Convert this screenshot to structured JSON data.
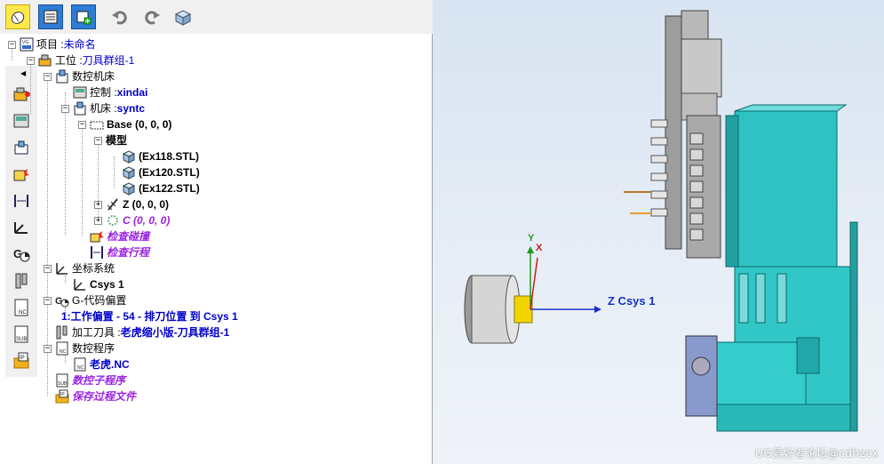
{
  "toolbar": {
    "buttons": [
      "mouse-select-icon",
      "document-list-icon",
      "add-component-icon",
      "undo-icon",
      "redo-icon",
      "view-cube-icon"
    ]
  },
  "tree": {
    "project_label": "项目 : ",
    "project_value": "未命名",
    "station_label": "工位 : ",
    "station_value": "刀具群组-1",
    "nc_machine": "数控机床",
    "control_label": "控制 : ",
    "control_value": "xindai",
    "machine_label": "机床 : ",
    "machine_value": "syntc",
    "base": "Base (0, 0, 0)",
    "model": "模型",
    "stl1": "(Ex118.STL)",
    "stl2": "(Ex120.STL)",
    "stl3": "(Ex122.STL)",
    "z_axis": "Z (0, 0, 0)",
    "c_axis": "C (0, 0, 0)",
    "collision": "检查碰撞",
    "travel": "检查行程",
    "coord_system": "坐标系统",
    "csys1": "Csys 1",
    "gcode_offset": "G-代码偏置",
    "offset_entry": "1:工作偏置 - 54 - 排刀位置 到 Csys 1",
    "tool_label": "加工刀具 : ",
    "tool_value": "老虎缩小版-刀具群组-1",
    "nc_program": "数控程序",
    "nc_file": "老虎.NC",
    "nc_subprogram": "数控子程序",
    "save_process": "保存过程文件"
  },
  "viewport": {
    "csys_label": "Z Csys 1",
    "axis_y": "Y",
    "axis_x": "X",
    "watermark": "UG爱好者论坛@cdhzcx"
  },
  "colors": {
    "link_blue": "#0000cc",
    "italic_purple": "#9a24e0",
    "machine_cyan": "#33cccc",
    "chuck_yellow": "#f2d400"
  }
}
